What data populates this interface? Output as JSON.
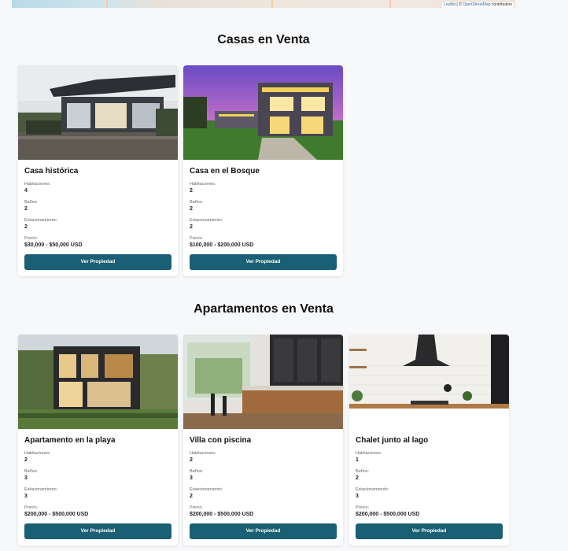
{
  "map": {
    "attribution_leaflet": "Leaflet",
    "attribution_sep": " | © ",
    "attribution_osm": "OpenStreetMap",
    "attribution_tail": " contributors"
  },
  "sections": [
    {
      "title": "Casas en Venta",
      "cards": [
        {
          "name": "Casa histórica",
          "rooms_label": "Habitaciones:",
          "rooms": "4",
          "baths_label": "Baños:",
          "baths": "2",
          "parking_label": "Estacionamiento:",
          "parking": "2",
          "price_label": "Precio:",
          "price": "$30,000 - $50,000 USD",
          "button": "Ver Propiedad",
          "image_icon": "modern-house-photo"
        },
        {
          "name": "Casa en el Bosque",
          "rooms_label": "Habitaciones:",
          "rooms": "2",
          "baths_label": "Baños:",
          "baths": "2",
          "parking_label": "Estacionamiento:",
          "parking": "2",
          "price_label": "Precio:",
          "price": "$100,000 - $200,000 USD",
          "button": "Ver Propiedad",
          "image_icon": "two-story-house-sunset-photo"
        }
      ]
    },
    {
      "title": "Apartamentos en Venta",
      "cards": [
        {
          "name": "Apartamento en la playa",
          "rooms_label": "Habitaciones:",
          "rooms": "2",
          "baths_label": "Baños:",
          "baths": "3",
          "parking_label": "Estacionamiento:",
          "parking": "3",
          "price_label": "Precio:",
          "price": "$200,000 - $500,000 USD",
          "button": "Ver Propiedad",
          "image_icon": "glass-house-photo"
        },
        {
          "name": "Villa con piscina",
          "rooms_label": "Habitaciones:",
          "rooms": "2",
          "baths_label": "Baños:",
          "baths": "3",
          "parking_label": "Estacionamiento:",
          "parking": "2",
          "price_label": "Precio:",
          "price": "$200,000 - $500,000 USD",
          "button": "Ver Propiedad",
          "image_icon": "dark-kitchen-photo"
        },
        {
          "name": "Chalet junto al lago",
          "rooms_label": "Habitaciones:",
          "rooms": "1",
          "baths_label": "Baños:",
          "baths": "2",
          "parking_label": "Estacionamiento:",
          "parking": "3",
          "price_label": "Precio:",
          "price": "$200,000 - $500,000 USD",
          "button": "Ver Propiedad",
          "image_icon": "white-kitchen-photo"
        }
      ]
    }
  ],
  "colors": {
    "button": "#1a5f73",
    "page_bg": "#f7f8fa"
  }
}
